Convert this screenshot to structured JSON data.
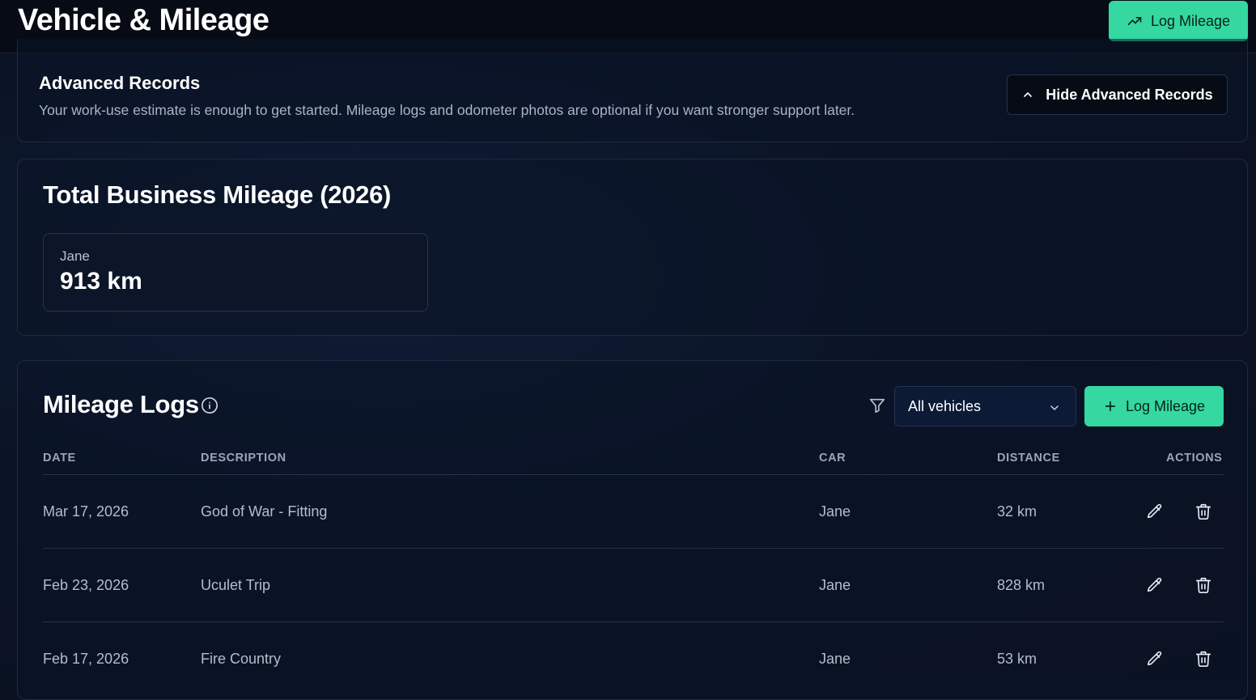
{
  "header": {
    "title": "Vehicle & Mileage",
    "log_button": "Log Mileage"
  },
  "advanced": {
    "title": "Advanced Records",
    "description": "Your work-use estimate is enough to get started. Mileage logs and odometer photos are optional if you want stronger support later.",
    "hide_button": "Hide Advanced Records"
  },
  "totals": {
    "title": "Total Business Mileage (2026)",
    "vehicles": [
      {
        "name": "Jane",
        "value": "913 km"
      }
    ]
  },
  "logs": {
    "title": "Mileage Logs",
    "vehicle_filter": {
      "selected": "All vehicles"
    },
    "add_button": "Log Mileage",
    "columns": [
      "DATE",
      "DESCRIPTION",
      "CAR",
      "DISTANCE",
      "ACTIONS"
    ],
    "rows": [
      {
        "date": "Mar 17, 2026",
        "description": "God of War - Fitting",
        "car": "Jane",
        "distance": "32 km"
      },
      {
        "date": "Feb 23, 2026",
        "description": "Uculet Trip",
        "car": "Jane",
        "distance": "828 km"
      },
      {
        "date": "Feb 17, 2026",
        "description": "Fire Country",
        "car": "Jane",
        "distance": "53 km"
      }
    ]
  },
  "colors": {
    "accent": "#34d8a0",
    "background": "#0a1222",
    "topbar": "#060b15"
  },
  "icons": [
    "trending-up-icon",
    "chevron-up-icon",
    "info-icon",
    "filter-icon",
    "chevron-down-icon",
    "plus-icon",
    "pencil-icon",
    "trash-icon"
  ]
}
